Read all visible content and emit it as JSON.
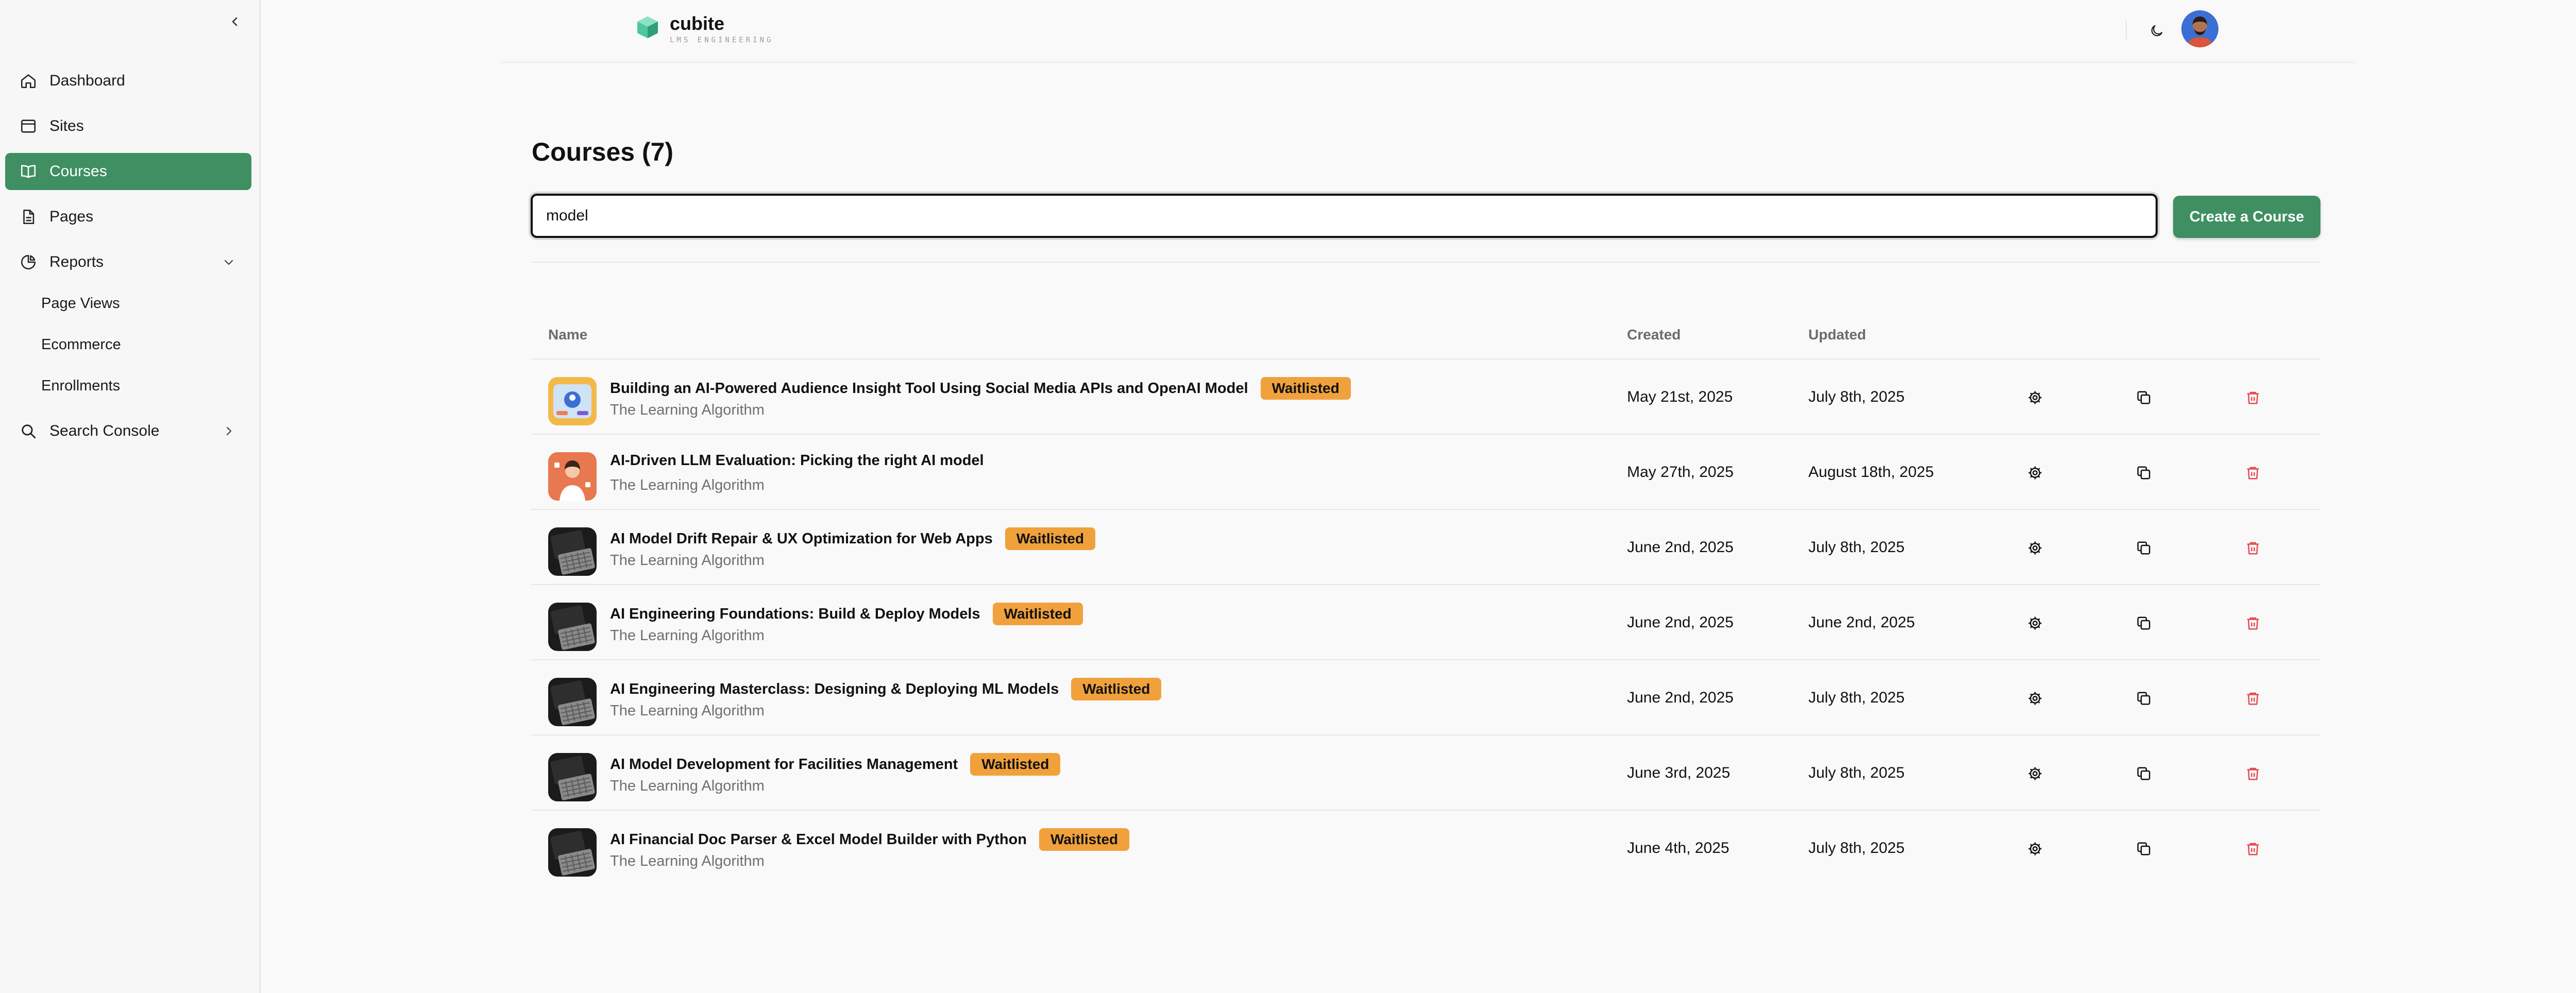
{
  "sidebar": {
    "items": [
      {
        "label": "Dashboard",
        "icon": "home-icon"
      },
      {
        "label": "Sites",
        "icon": "browser-icon"
      },
      {
        "label": "Courses",
        "icon": "book-icon",
        "active": true
      },
      {
        "label": "Pages",
        "icon": "document-icon"
      },
      {
        "label": "Reports",
        "icon": "pie-chart-icon",
        "expanded": true
      },
      {
        "label": "Search Console",
        "icon": "search-icon"
      }
    ],
    "report_subitems": [
      {
        "label": "Page Views"
      },
      {
        "label": "Ecommerce"
      },
      {
        "label": "Enrollments"
      }
    ]
  },
  "header": {
    "brand": "cubite",
    "tagline": "LMS ENGINEERING"
  },
  "main": {
    "title": "Courses (7)",
    "search": {
      "value": "model"
    },
    "create_button": "Create a Course",
    "table": {
      "columns": {
        "name": "Name",
        "created": "Created",
        "updated": "Updated"
      },
      "rows": [
        {
          "title": "Building an AI-Powered Audience Insight Tool Using Social Media APIs and OpenAI Model",
          "subtitle": "The Learning Algorithm",
          "badge": "Waitlisted",
          "created": "May 21st, 2025",
          "updated": "July 8th, 2025",
          "thumb": "illustration-blue"
        },
        {
          "title": "AI-Driven LLM Evaluation: Picking the right AI model",
          "subtitle": "The Learning Algorithm",
          "badge": "",
          "created": "May 27th, 2025",
          "updated": "August 18th, 2025",
          "thumb": "illustration-orange"
        },
        {
          "title": "AI Model Drift Repair & UX Optimization for Web Apps",
          "subtitle": "The Learning Algorithm",
          "badge": "Waitlisted",
          "created": "June 2nd, 2025",
          "updated": "July 8th, 2025",
          "thumb": "laptop-dark"
        },
        {
          "title": "AI Engineering Foundations: Build & Deploy Models",
          "subtitle": "The Learning Algorithm",
          "badge": "Waitlisted",
          "created": "June 2nd, 2025",
          "updated": "June 2nd, 2025",
          "thumb": "laptop-dark"
        },
        {
          "title": "AI Engineering Masterclass: Designing & Deploying ML Models",
          "subtitle": "The Learning Algorithm",
          "badge": "Waitlisted",
          "created": "June 2nd, 2025",
          "updated": "July 8th, 2025",
          "thumb": "laptop-dark"
        },
        {
          "title": "AI Model Development for Facilities Management",
          "subtitle": "The Learning Algorithm",
          "badge": "Waitlisted",
          "created": "June 3rd, 2025",
          "updated": "July 8th, 2025",
          "thumb": "laptop-dark"
        },
        {
          "title": "AI Financial Doc Parser & Excel Model Builder with Python",
          "subtitle": "The Learning Algorithm",
          "badge": "Waitlisted",
          "created": "June 4th, 2025",
          "updated": "July 8th, 2025",
          "thumb": "laptop-dark"
        }
      ]
    }
  },
  "colors": {
    "accent": "#3f8f62",
    "badge": "#f0a13c",
    "danger": "#e5484d",
    "brand_mark": "#4fc6a0"
  }
}
